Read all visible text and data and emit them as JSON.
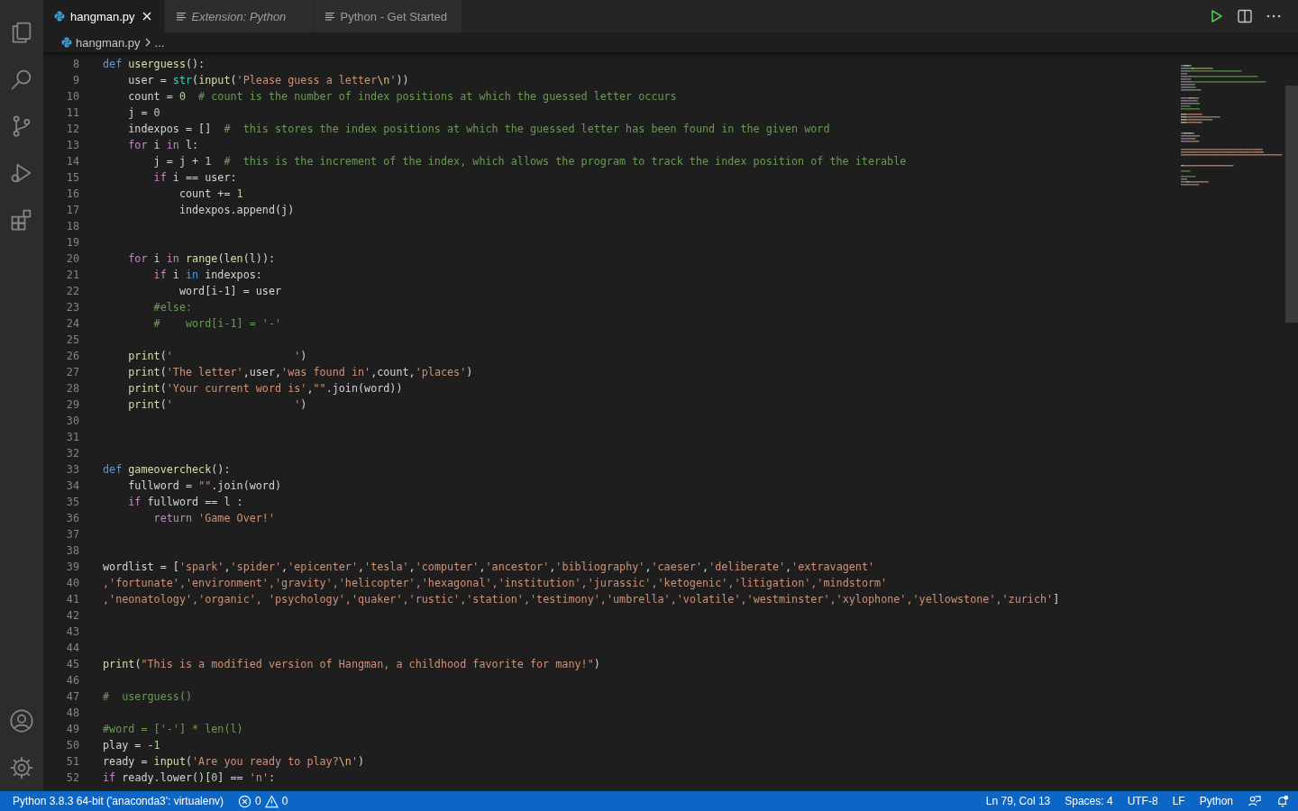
{
  "tabs": [
    {
      "label": "hangman.py",
      "kind": "file",
      "selected": true,
      "preview": false
    },
    {
      "label": "Extension: Python",
      "kind": "page",
      "selected": false,
      "preview": true
    },
    {
      "label": "Python - Get Started",
      "kind": "page",
      "selected": false,
      "preview": false
    }
  ],
  "breadcrumb": {
    "file": "hangman.py",
    "more": "..."
  },
  "editor": {
    "lines": [
      {
        "number": "8",
        "tokens": [
          {
            "kind": "storage",
            "text": "def "
          },
          {
            "kind": "function",
            "text": "userguess"
          },
          {
            "kind": "plain",
            "text": "():"
          }
        ]
      },
      {
        "number": "9",
        "tokens": [
          {
            "kind": "plain",
            "text": "    user = "
          },
          {
            "kind": "builtin",
            "text": "str"
          },
          {
            "kind": "plain",
            "text": "("
          },
          {
            "kind": "function",
            "text": "input"
          },
          {
            "kind": "plain",
            "text": "("
          },
          {
            "kind": "string",
            "text": "'Please guess a letter"
          },
          {
            "kind": "escape",
            "text": "\\n"
          },
          {
            "kind": "string",
            "text": "'"
          },
          {
            "kind": "plain",
            "text": "))"
          }
        ]
      },
      {
        "number": "10",
        "tokens": [
          {
            "kind": "plain",
            "text": "    count = "
          },
          {
            "kind": "number",
            "text": "0"
          },
          {
            "kind": "comment",
            "text": "  # count is the number of index positions at which the guessed letter occurs"
          }
        ]
      },
      {
        "number": "11",
        "tokens": [
          {
            "kind": "plain",
            "text": "    j = "
          },
          {
            "kind": "number",
            "text": "0"
          }
        ]
      },
      {
        "number": "12",
        "tokens": [
          {
            "kind": "plain",
            "text": "    indexpos = []"
          },
          {
            "kind": "comment",
            "text": "  #  this stores the index positions at which the guessed letter has been found in the given word"
          }
        ]
      },
      {
        "number": "13",
        "tokens": [
          {
            "kind": "keyword",
            "text": "    for"
          },
          {
            "kind": "plain",
            "text": " i "
          },
          {
            "kind": "keyword",
            "text": "in"
          },
          {
            "kind": "plain",
            "text": " l:"
          }
        ]
      },
      {
        "number": "14",
        "tokens": [
          {
            "kind": "plain",
            "text": "        j = j + "
          },
          {
            "kind": "number",
            "text": "1"
          },
          {
            "kind": "comment",
            "text": "  #  this is the increment of the index, which allows the program to track the index position of the iterable"
          }
        ]
      },
      {
        "number": "15",
        "tokens": [
          {
            "kind": "keyword",
            "text": "        if"
          },
          {
            "kind": "plain",
            "text": " i == user:"
          }
        ]
      },
      {
        "number": "16",
        "tokens": [
          {
            "kind": "plain",
            "text": "            count += "
          },
          {
            "kind": "number",
            "text": "1"
          }
        ]
      },
      {
        "number": "17",
        "tokens": [
          {
            "kind": "plain",
            "text": "            indexpos.append(j)"
          }
        ]
      },
      {
        "number": "18"
      },
      {
        "number": "19"
      },
      {
        "number": "20",
        "tokens": [
          {
            "kind": "keyword",
            "text": "    for"
          },
          {
            "kind": "plain",
            "text": " i "
          },
          {
            "kind": "keyword",
            "text": "in"
          },
          {
            "kind": "function",
            "text": " range"
          },
          {
            "kind": "plain",
            "text": "("
          },
          {
            "kind": "function",
            "text": "len"
          },
          {
            "kind": "plain",
            "text": "(l)):"
          }
        ]
      },
      {
        "number": "21",
        "tokens": [
          {
            "kind": "keyword",
            "text": "        if"
          },
          {
            "kind": "plain",
            "text": " i "
          },
          {
            "kind": "storage",
            "text": "in"
          },
          {
            "kind": "plain",
            "text": " indexpos:"
          }
        ]
      },
      {
        "number": "22",
        "tokens": [
          {
            "kind": "plain",
            "text": "            word[i-1] = user"
          }
        ]
      },
      {
        "number": "23",
        "tokens": [
          {
            "kind": "comment",
            "text": "        #else:"
          }
        ]
      },
      {
        "number": "24",
        "tokens": [
          {
            "kind": "comment",
            "text": "        #    word[i-1] = '-'"
          }
        ]
      },
      {
        "number": "25"
      },
      {
        "number": "26",
        "tokens": [
          {
            "kind": "function",
            "text": "    print"
          },
          {
            "kind": "plain",
            "text": "("
          },
          {
            "kind": "string",
            "text": "'                   '"
          },
          {
            "kind": "plain",
            "text": ")"
          }
        ]
      },
      {
        "number": "27",
        "tokens": [
          {
            "kind": "function",
            "text": "    print"
          },
          {
            "kind": "plain",
            "text": "("
          },
          {
            "kind": "string",
            "text": "'The letter'"
          },
          {
            "kind": "plain",
            "text": ",user,"
          },
          {
            "kind": "string",
            "text": "'was found in'"
          },
          {
            "kind": "plain",
            "text": ",count,"
          },
          {
            "kind": "string",
            "text": "'places'"
          },
          {
            "kind": "plain",
            "text": ")"
          }
        ]
      },
      {
        "number": "28",
        "tokens": [
          {
            "kind": "function",
            "text": "    print"
          },
          {
            "kind": "plain",
            "text": "("
          },
          {
            "kind": "string",
            "text": "'Your current word is'"
          },
          {
            "kind": "plain",
            "text": ","
          },
          {
            "kind": "string",
            "text": "\"\""
          },
          {
            "kind": "plain",
            "text": ".join(word))"
          }
        ]
      },
      {
        "number": "29",
        "tokens": [
          {
            "kind": "function",
            "text": "    print"
          },
          {
            "kind": "plain",
            "text": "("
          },
          {
            "kind": "string",
            "text": "'                   '"
          },
          {
            "kind": "plain",
            "text": ")"
          }
        ]
      },
      {
        "number": "30"
      },
      {
        "number": "31"
      },
      {
        "number": "32"
      },
      {
        "number": "33",
        "tokens": [
          {
            "kind": "storage",
            "text": "def "
          },
          {
            "kind": "function",
            "text": "gameovercheck"
          },
          {
            "kind": "plain",
            "text": "():"
          }
        ]
      },
      {
        "number": "34",
        "tokens": [
          {
            "kind": "plain",
            "text": "    fullword = "
          },
          {
            "kind": "string",
            "text": "\"\""
          },
          {
            "kind": "plain",
            "text": ".join(word)"
          }
        ]
      },
      {
        "number": "35",
        "tokens": [
          {
            "kind": "keyword",
            "text": "    if"
          },
          {
            "kind": "plain",
            "text": " fullword == l :"
          }
        ]
      },
      {
        "number": "36",
        "tokens": [
          {
            "kind": "keyword",
            "text": "        return"
          },
          {
            "kind": "string",
            "text": " 'Game Over!'"
          }
        ]
      },
      {
        "number": "37"
      },
      {
        "number": "38"
      },
      {
        "number": "39",
        "tokens": [
          {
            "kind": "plain",
            "text": "wordlist = ["
          },
          {
            "kind": "string",
            "text": "'spark'"
          },
          {
            "kind": "plain",
            "text": ","
          },
          {
            "kind": "string",
            "text": "'spider'"
          },
          {
            "kind": "plain",
            "text": ","
          },
          {
            "kind": "string",
            "text": "'epicenter'"
          },
          {
            "kind": "plain",
            "text": ","
          },
          {
            "kind": "string",
            "text": "'tesla'"
          },
          {
            "kind": "plain",
            "text": ","
          },
          {
            "kind": "string",
            "text": "'computer'"
          },
          {
            "kind": "plain",
            "text": ","
          },
          {
            "kind": "string",
            "text": "'ancestor'"
          },
          {
            "kind": "plain",
            "text": ","
          },
          {
            "kind": "string",
            "text": "'bibliography'"
          },
          {
            "kind": "plain",
            "text": ","
          },
          {
            "kind": "string",
            "text": "'caeser'"
          },
          {
            "kind": "plain",
            "text": ","
          },
          {
            "kind": "string",
            "text": "'deliberate'"
          },
          {
            "kind": "plain",
            "text": ","
          },
          {
            "kind": "string",
            "text": "'extravagent'"
          }
        ]
      },
      {
        "number": "40",
        "tokens": [
          {
            "kind": "string",
            "text": ",'fortunate',"
          },
          {
            "kind": "string",
            "text": "'environment',"
          },
          {
            "kind": "string",
            "text": "'gravity',"
          },
          {
            "kind": "string",
            "text": "'helicopter',"
          },
          {
            "kind": "string",
            "text": "'hexagonal',"
          },
          {
            "kind": "string",
            "text": "'institution',"
          },
          {
            "kind": "string",
            "text": "'jurassic',"
          },
          {
            "kind": "string",
            "text": "'ketogenic',"
          },
          {
            "kind": "string",
            "text": "'litigation',"
          },
          {
            "kind": "string",
            "text": "'mindstorm'"
          }
        ]
      },
      {
        "number": "41",
        "tokens": [
          {
            "kind": "string",
            "text": ",'neonatology',"
          },
          {
            "kind": "string",
            "text": "'organic',"
          },
          {
            "kind": "string",
            "text": " 'psychology',"
          },
          {
            "kind": "string",
            "text": "'quaker',"
          },
          {
            "kind": "string",
            "text": "'rustic',"
          },
          {
            "kind": "string",
            "text": "'station',"
          },
          {
            "kind": "string",
            "text": "'testimony',"
          },
          {
            "kind": "string",
            "text": "'umbrella',"
          },
          {
            "kind": "string",
            "text": "'volatile',"
          },
          {
            "kind": "string",
            "text": "'westminster',"
          },
          {
            "kind": "string",
            "text": "'xylophone',"
          },
          {
            "kind": "string",
            "text": "'yellowstone',"
          },
          {
            "kind": "string",
            "text": "'zurich'"
          },
          {
            "kind": "plain",
            "text": "]"
          }
        ]
      },
      {
        "number": "42"
      },
      {
        "number": "43"
      },
      {
        "number": "44"
      },
      {
        "number": "45",
        "tokens": [
          {
            "kind": "function",
            "text": "print"
          },
          {
            "kind": "plain",
            "text": "("
          },
          {
            "kind": "string",
            "text": "\"This is a modified version of Hangman, a childhood favorite for many!\""
          },
          {
            "kind": "plain",
            "text": ")"
          }
        ]
      },
      {
        "number": "46"
      },
      {
        "number": "47",
        "tokens": [
          {
            "kind": "comment",
            "text": "#  userguess()"
          }
        ]
      },
      {
        "number": "48"
      },
      {
        "number": "49",
        "tokens": [
          {
            "kind": "comment",
            "text": "#word = ['-'] * len(l)"
          }
        ]
      },
      {
        "number": "50",
        "tokens": [
          {
            "kind": "plain",
            "text": "play = -"
          },
          {
            "kind": "number",
            "text": "1"
          }
        ]
      },
      {
        "number": "51",
        "tokens": [
          {
            "kind": "plain",
            "text": "ready = "
          },
          {
            "kind": "function",
            "text": "input"
          },
          {
            "kind": "plain",
            "text": "("
          },
          {
            "kind": "string",
            "text": "'Are you ready to play?"
          },
          {
            "kind": "escape",
            "text": "\\n"
          },
          {
            "kind": "string",
            "text": "'"
          },
          {
            "kind": "plain",
            "text": ")"
          }
        ]
      },
      {
        "number": "52",
        "tokens": [
          {
            "kind": "keyword",
            "text": "if"
          },
          {
            "kind": "plain",
            "text": " ready.lower()["
          },
          {
            "kind": "number",
            "text": "0"
          },
          {
            "kind": "plain",
            "text": "] == "
          },
          {
            "kind": "string",
            "text": "'n'"
          },
          {
            "kind": "plain",
            "text": ":"
          }
        ]
      }
    ]
  },
  "status_bar": {
    "interpreter": "Python 3.8.3 64-bit ('anaconda3': virtualenv)",
    "errors": "0",
    "warnings": "0",
    "right": [
      "Ln 79, Col 13",
      "Spaces: 4",
      "UTF-8",
      "LF",
      "Python"
    ]
  }
}
